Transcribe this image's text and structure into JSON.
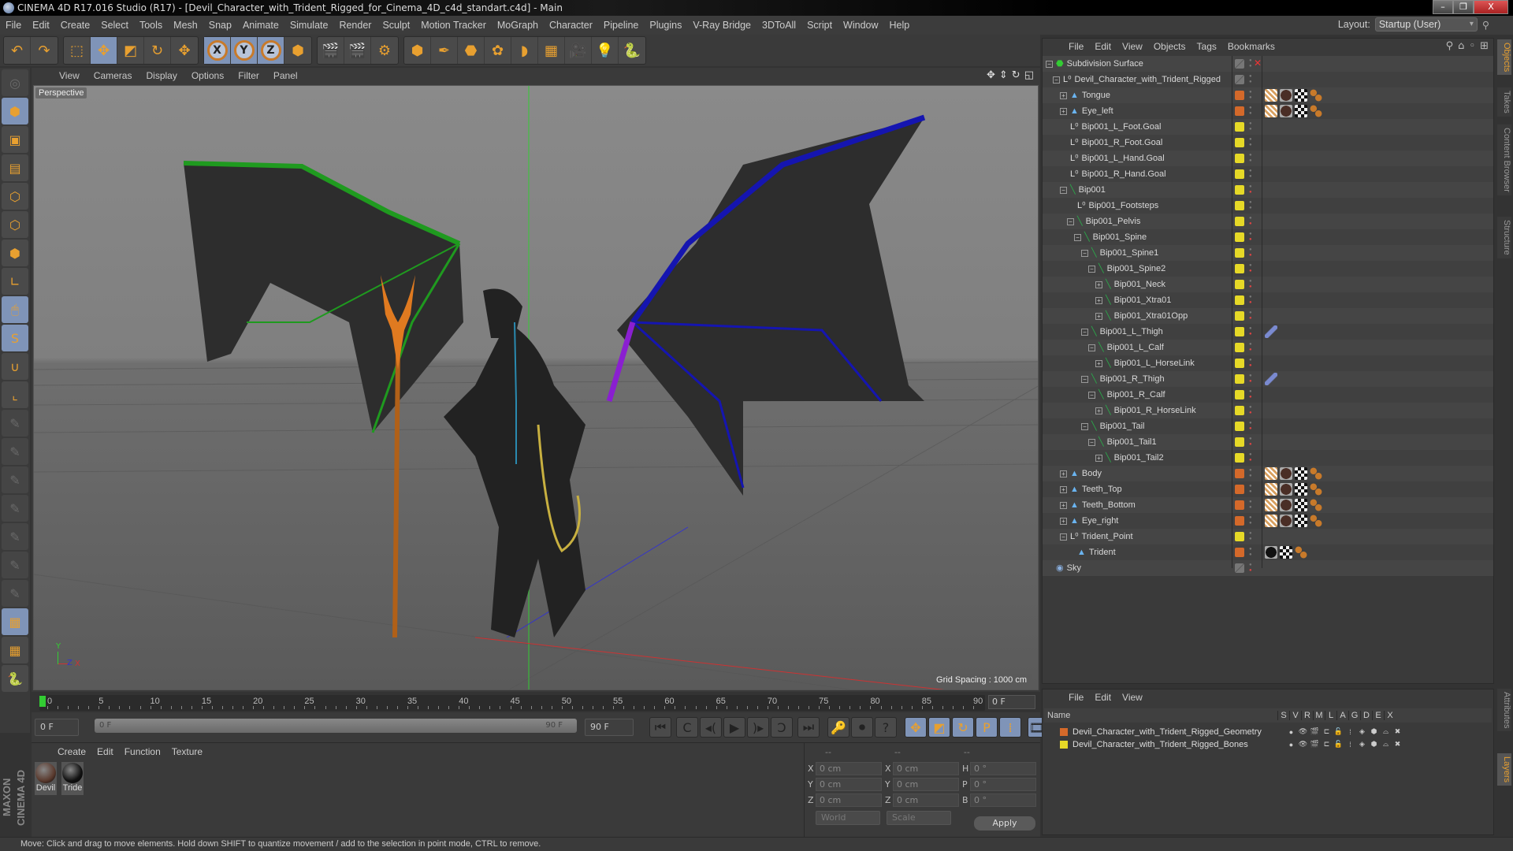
{
  "window": {
    "title": "CINEMA 4D R17.016 Studio (R17) - [Devil_Character_with_Trident_Rigged_for_Cinema_4D_c4d_standart.c4d] - Main",
    "buttons": {
      "minimize": "–",
      "restore": "❐",
      "close": "X"
    }
  },
  "menu": [
    "File",
    "Edit",
    "Create",
    "Select",
    "Tools",
    "Mesh",
    "Snap",
    "Animate",
    "Simulate",
    "Render",
    "Sculpt",
    "Motion Tracker",
    "MoGraph",
    "Character",
    "Pipeline",
    "Plugins",
    "V-Ray Bridge",
    "3DToAll",
    "Script",
    "Window",
    "Help"
  ],
  "layout": {
    "label": "Layout:",
    "value": "Startup (User)"
  },
  "toolbar": {
    "groups": [
      [
        {
          "icon": "undo-icon",
          "glyph": "↶",
          "on": false
        },
        {
          "icon": "redo-icon",
          "glyph": "↷",
          "on": false
        }
      ],
      [
        {
          "icon": "live-selection-icon",
          "glyph": "⬚",
          "on": false
        },
        {
          "icon": "move-icon",
          "glyph": "✥",
          "on": true
        },
        {
          "icon": "scale-icon",
          "glyph": "◩",
          "on": false
        },
        {
          "icon": "rotate-icon",
          "glyph": "↻",
          "on": false
        },
        {
          "icon": "last-tool-icon",
          "glyph": "✥",
          "on": false
        }
      ],
      [
        {
          "icon": "x-axis-icon",
          "glyph": "X",
          "on": true,
          "axis": true
        },
        {
          "icon": "y-axis-icon",
          "glyph": "Y",
          "on": true,
          "axis": true
        },
        {
          "icon": "z-axis-icon",
          "glyph": "Z",
          "on": true,
          "axis": true
        },
        {
          "icon": "coordinate-system-icon",
          "glyph": "⬢",
          "on": false
        }
      ],
      [
        {
          "icon": "render-view-icon",
          "glyph": "🎬",
          "on": false
        },
        {
          "icon": "render-picture-viewer-icon",
          "glyph": "🎬",
          "on": false
        },
        {
          "icon": "render-settings-icon",
          "glyph": "⚙",
          "on": false
        }
      ],
      [
        {
          "icon": "cube-icon",
          "glyph": "⬢",
          "on": false
        },
        {
          "icon": "pen-spline-icon",
          "glyph": "✒",
          "on": false
        },
        {
          "icon": "subdivision-surface-icon",
          "glyph": "⬣",
          "on": false
        },
        {
          "icon": "cloner-icon",
          "glyph": "✿",
          "on": false
        },
        {
          "icon": "deformer-icon",
          "glyph": "◗",
          "on": false
        },
        {
          "icon": "floor-icon",
          "glyph": "▦",
          "on": false
        },
        {
          "icon": "camera-icon",
          "glyph": "🎥",
          "on": false
        },
        {
          "icon": "light-icon",
          "glyph": "💡",
          "on": false
        },
        {
          "icon": "python-icon",
          "glyph": "🐍",
          "on": false
        }
      ]
    ]
  },
  "left_tools": [
    {
      "icon": "make-editable-icon",
      "glyph": "◎",
      "state": "dim"
    },
    {
      "icon": "model-mode-icon",
      "glyph": "⬢",
      "state": "on"
    },
    {
      "icon": "texture-mode-icon",
      "glyph": "▣",
      "state": ""
    },
    {
      "icon": "workplane-mode-icon",
      "glyph": "▤",
      "state": ""
    },
    {
      "icon": "points-mode-icon",
      "glyph": "⬡",
      "state": ""
    },
    {
      "icon": "edges-mode-icon",
      "glyph": "⬡",
      "state": ""
    },
    {
      "icon": "polygons-mode-icon",
      "glyph": "⬢",
      "state": ""
    },
    {
      "icon": "axis-mode-icon",
      "glyph": "∟",
      "state": ""
    },
    {
      "icon": "tweak-mode-icon",
      "glyph": "🖱",
      "state": "on"
    },
    {
      "icon": "solo-mode-icon",
      "glyph": "S",
      "state": "on"
    },
    {
      "icon": "snap-magnet-icon",
      "glyph": "∪",
      "state": ""
    },
    {
      "icon": "workplane-axis-icon",
      "glyph": "⌞",
      "state": ""
    },
    {
      "icon": "joint-tool-icon",
      "glyph": "✎",
      "state": "dim"
    },
    {
      "icon": "ik-p-icon",
      "glyph": "✎",
      "state": "dim"
    },
    {
      "icon": "ik-r-icon",
      "glyph": "✎",
      "state": "dim"
    },
    {
      "icon": "ik-psr-icon",
      "glyph": "✎",
      "state": "dim"
    },
    {
      "icon": "ik-target-icon",
      "glyph": "✎",
      "state": "dim"
    },
    {
      "icon": "ik-pole-icon",
      "glyph": "✎",
      "state": "dim"
    },
    {
      "icon": "ik-link-icon",
      "glyph": "✎",
      "state": "dim"
    },
    {
      "icon": "lock-workplane-icon",
      "glyph": "▦",
      "state": "on"
    },
    {
      "icon": "workplane-refresh-icon",
      "glyph": "▦",
      "state": ""
    },
    {
      "icon": "python-script-icon",
      "glyph": "🐍",
      "state": ""
    }
  ],
  "viewport": {
    "menu": [
      "View",
      "Cameras",
      "Display",
      "Options",
      "Filter",
      "Panel"
    ],
    "label": "Perspective",
    "grid_spacing": "Grid Spacing : 1000 cm",
    "nav_icons": [
      {
        "icon": "pan-icon",
        "glyph": "✥"
      },
      {
        "icon": "zoom-dolly-icon",
        "glyph": "⇕"
      },
      {
        "icon": "orbit-icon",
        "glyph": "↻"
      },
      {
        "icon": "maximize-view-icon",
        "glyph": "◱"
      }
    ],
    "axis_labels": {
      "x": "X",
      "y": "Y",
      "z": "Z"
    }
  },
  "timeline": {
    "ticks": [
      "0",
      "5",
      "10",
      "15",
      "20",
      "25",
      "30",
      "35",
      "40",
      "45",
      "50",
      "55",
      "60",
      "65",
      "70",
      "75",
      "80",
      "85",
      "90"
    ],
    "current_frame": "0 F",
    "start": "0 F",
    "range_start": "0 F",
    "range_end": "90 F",
    "end": "90 F"
  },
  "transport": [
    {
      "icon": "go-to-start-icon",
      "glyph": "⏮"
    },
    {
      "icon": "previous-key-icon",
      "glyph": "C"
    },
    {
      "icon": "previous-frame-icon",
      "glyph": "◂("
    },
    {
      "icon": "play-forward-icon",
      "glyph": "▶"
    },
    {
      "icon": "next-frame-icon",
      "glyph": ")▸"
    },
    {
      "icon": "next-key-icon",
      "glyph": "Ɔ"
    },
    {
      "icon": "go-to-end-icon",
      "glyph": "⏭"
    }
  ],
  "key_tools": [
    {
      "icon": "record-keys-icon",
      "glyph": "🔑"
    },
    {
      "icon": "autokeying-icon",
      "glyph": "⏺"
    },
    {
      "icon": "keyframe-selection-icon",
      "glyph": "?"
    }
  ],
  "key_channels": [
    {
      "icon": "key-position-icon",
      "glyph": "✥"
    },
    {
      "icon": "key-scale-icon",
      "glyph": "◩"
    },
    {
      "icon": "key-rotation-icon",
      "glyph": "↻"
    },
    {
      "icon": "key-parameter-icon",
      "glyph": "P"
    },
    {
      "icon": "key-pla-icon",
      "glyph": "⁞"
    }
  ],
  "timeline_layout_icon": {
    "icon": "timeline-layout-icon",
    "glyph": "🎞"
  },
  "materials": {
    "menu": [
      "Create",
      "Edit",
      "Function",
      "Texture"
    ],
    "items": [
      {
        "name": "Devil",
        "color": "#5a3a2e"
      },
      {
        "name": "Tride",
        "color": "#111111"
      }
    ]
  },
  "coordinates": {
    "headers": [
      "--",
      "--",
      "--"
    ],
    "position": [
      {
        "axis": "X",
        "value": "0 cm"
      },
      {
        "axis": "Y",
        "value": "0 cm"
      },
      {
        "axis": "Z",
        "value": "0 cm"
      }
    ],
    "size": [
      {
        "axis": "X",
        "value": "0 cm"
      },
      {
        "axis": "Y",
        "value": "0 cm"
      },
      {
        "axis": "Z",
        "value": "0 cm"
      }
    ],
    "rotation": [
      {
        "axis": "H",
        "value": "0 °"
      },
      {
        "axis": "P",
        "value": "0 °"
      },
      {
        "axis": "B",
        "value": "0 °"
      }
    ],
    "mode": "World",
    "size_mode": "Scale",
    "apply_label": "Apply"
  },
  "status_text": "Move: Click and drag to move elements. Hold down SHIFT to quantize movement / add to the selection in point mode, CTRL to remove.",
  "brand": "MAXON CINEMA 4D",
  "object_manager": {
    "menu": [
      "File",
      "Edit",
      "View",
      "Objects",
      "Tags",
      "Bookmarks"
    ],
    "tools": [
      {
        "icon": "search-icon",
        "glyph": "⚲"
      },
      {
        "icon": "home-icon",
        "glyph": "⌂"
      },
      {
        "icon": "visibility-icon",
        "glyph": "◦"
      },
      {
        "icon": "new-window-icon",
        "glyph": "⊞"
      }
    ],
    "objects": [
      {
        "name": "Subdivision Surface",
        "depth": 0,
        "exp": "−",
        "type": "subdivision",
        "layer": "none",
        "tags": [],
        "xmark": true
      },
      {
        "name": "Devil_Character_with_Trident_Rigged",
        "depth": 1,
        "exp": "−",
        "type": "null",
        "layer": "none",
        "tags": []
      },
      {
        "name": "Tongue",
        "depth": 2,
        "exp": "+",
        "type": "polygon",
        "layer": "#d4692a",
        "tags": [
          "weight",
          "material",
          "texture",
          "points"
        ]
      },
      {
        "name": "Eye_left",
        "depth": 2,
        "exp": "+",
        "type": "polygon",
        "layer": "#d4692a",
        "tags": [
          "weight",
          "material",
          "texture",
          "points"
        ]
      },
      {
        "name": "Bip001_L_Foot.Goal",
        "depth": 2,
        "exp": "",
        "type": "null",
        "layer": "#e6d927",
        "tags": []
      },
      {
        "name": "Bip001_R_Foot.Goal",
        "depth": 2,
        "exp": "",
        "type": "null",
        "layer": "#e6d927",
        "tags": []
      },
      {
        "name": "Bip001_L_Hand.Goal",
        "depth": 2,
        "exp": "",
        "type": "null",
        "layer": "#e6d927",
        "tags": []
      },
      {
        "name": "Bip001_R_Hand.Goal",
        "depth": 2,
        "exp": "",
        "type": "null",
        "layer": "#e6d927",
        "tags": []
      },
      {
        "name": "Bip001",
        "depth": 2,
        "exp": "−",
        "type": "joint",
        "layer": "#e6d927",
        "tags": []
      },
      {
        "name": "Bip001_Footsteps",
        "depth": 3,
        "exp": "",
        "type": "null",
        "layer": "#e6d927",
        "tags": []
      },
      {
        "name": "Bip001_Pelvis",
        "depth": 3,
        "exp": "−",
        "type": "joint",
        "layer": "#e6d927",
        "tags": []
      },
      {
        "name": "Bip001_Spine",
        "depth": 4,
        "exp": "−",
        "type": "joint",
        "layer": "#e6d927",
        "tags": []
      },
      {
        "name": "Bip001_Spine1",
        "depth": 5,
        "exp": "−",
        "type": "joint",
        "layer": "#e6d927",
        "tags": []
      },
      {
        "name": "Bip001_Spine2",
        "depth": 6,
        "exp": "−",
        "type": "joint",
        "layer": "#e6d927",
        "tags": []
      },
      {
        "name": "Bip001_Neck",
        "depth": 7,
        "exp": "+",
        "type": "joint",
        "layer": "#e6d927",
        "tags": []
      },
      {
        "name": "Bip001_Xtra01",
        "depth": 7,
        "exp": "+",
        "type": "joint",
        "layer": "#e6d927",
        "tags": []
      },
      {
        "name": "Bip001_Xtra01Opp",
        "depth": 7,
        "exp": "+",
        "type": "joint",
        "layer": "#e6d927",
        "tags": []
      },
      {
        "name": "Bip001_L_Thigh",
        "depth": 5,
        "exp": "−",
        "type": "joint",
        "layer": "#e6d927",
        "tags": [
          "ik"
        ]
      },
      {
        "name": "Bip001_L_Calf",
        "depth": 6,
        "exp": "−",
        "type": "joint",
        "layer": "#e6d927",
        "tags": []
      },
      {
        "name": "Bip001_L_HorseLink",
        "depth": 7,
        "exp": "+",
        "type": "joint",
        "layer": "#e6d927",
        "tags": []
      },
      {
        "name": "Bip001_R_Thigh",
        "depth": 5,
        "exp": "−",
        "type": "joint",
        "layer": "#e6d927",
        "tags": [
          "ik"
        ]
      },
      {
        "name": "Bip001_R_Calf",
        "depth": 6,
        "exp": "−",
        "type": "joint",
        "layer": "#e6d927",
        "tags": []
      },
      {
        "name": "Bip001_R_HorseLink",
        "depth": 7,
        "exp": "+",
        "type": "joint",
        "layer": "#e6d927",
        "tags": []
      },
      {
        "name": "Bip001_Tail",
        "depth": 5,
        "exp": "−",
        "type": "joint",
        "layer": "#e6d927",
        "tags": []
      },
      {
        "name": "Bip001_Tail1",
        "depth": 6,
        "exp": "−",
        "type": "joint",
        "layer": "#e6d927",
        "tags": []
      },
      {
        "name": "Bip001_Tail2",
        "depth": 7,
        "exp": "+",
        "type": "joint",
        "layer": "#e6d927",
        "tags": []
      },
      {
        "name": "Body",
        "depth": 2,
        "exp": "+",
        "type": "polygon",
        "layer": "#d4692a",
        "tags": [
          "weight",
          "material",
          "texture",
          "points"
        ]
      },
      {
        "name": "Teeth_Top",
        "depth": 2,
        "exp": "+",
        "type": "polygon",
        "layer": "#d4692a",
        "tags": [
          "weight",
          "material",
          "texture",
          "points"
        ]
      },
      {
        "name": "Teeth_Bottom",
        "depth": 2,
        "exp": "+",
        "type": "polygon",
        "layer": "#d4692a",
        "tags": [
          "weight",
          "material",
          "texture",
          "points"
        ]
      },
      {
        "name": "Eye_right",
        "depth": 2,
        "exp": "+",
        "type": "polygon",
        "layer": "#d4692a",
        "tags": [
          "weight",
          "material",
          "texture",
          "points"
        ]
      },
      {
        "name": "Trident_Point",
        "depth": 2,
        "exp": "−",
        "type": "null",
        "layer": "#e6d927",
        "tags": []
      },
      {
        "name": "Trident",
        "depth": 3,
        "exp": "",
        "type": "polygon",
        "layer": "#d4692a",
        "tags": [
          "material-black",
          "texture",
          "points"
        ]
      },
      {
        "name": "Sky",
        "depth": 0,
        "exp": "",
        "type": "sky",
        "layer": "none",
        "tags": []
      }
    ]
  },
  "layers": {
    "menu": [
      "File",
      "Edit",
      "View"
    ],
    "columns": [
      "Name",
      "S",
      "V",
      "R",
      "M",
      "L",
      "A",
      "G",
      "D",
      "E",
      "X"
    ],
    "items": [
      {
        "name": "Devil_Character_with_Trident_Rigged_Geometry",
        "color": "#d4692a"
      },
      {
        "name": "Devil_Character_with_Trident_Rigged_Bones",
        "color": "#e6d927"
      }
    ]
  },
  "side_tabs_top": [
    {
      "label": "Objects",
      "active": true
    },
    {
      "label": "Takes",
      "active": false
    },
    {
      "label": "Content Browser",
      "active": false
    },
    {
      "label": "Structure",
      "active": false
    }
  ],
  "side_tabs_bottom": [
    {
      "label": "Attributes",
      "active": false
    },
    {
      "label": "Layers",
      "active": true
    }
  ]
}
